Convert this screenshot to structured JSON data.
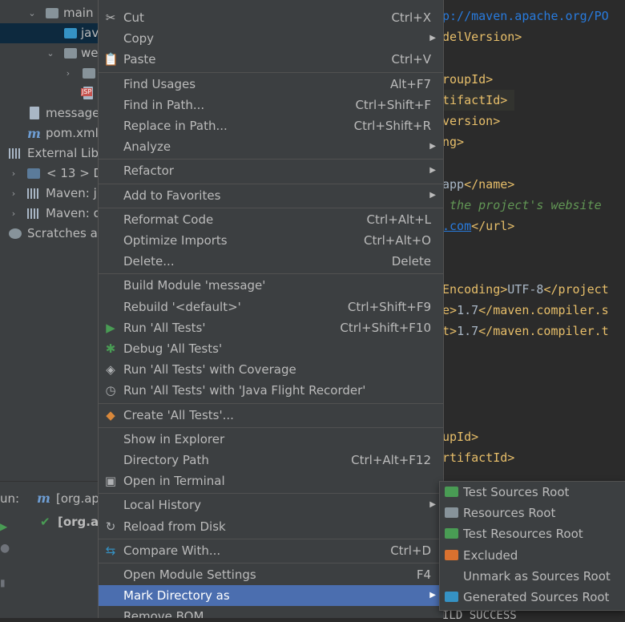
{
  "project_tree": {
    "rows": [
      {
        "label": "main"
      },
      {
        "label": "jav"
      },
      {
        "label": "we"
      },
      {
        "label": ""
      },
      {
        "label": "JSP"
      },
      {
        "label": "message"
      },
      {
        "label": "pom.xml"
      },
      {
        "label": "External Libr"
      },
      {
        "label": "< 13 >  D"
      },
      {
        "label": "Maven: ju"
      },
      {
        "label": "Maven: o"
      },
      {
        "label": "Scratches ar"
      }
    ],
    "maven_glyph": "m"
  },
  "editor": {
    "lines": [
      {
        "text": "p://maven.apache.org/PO",
        "kind": "url"
      },
      {
        "text": "delVersion>",
        "kind": "tag"
      },
      {
        "text": "",
        "kind": "txt"
      },
      {
        "text": "roupId>",
        "kind": "tag"
      },
      {
        "text": "tifactId>",
        "kind": "tag"
      },
      {
        "text": "version>",
        "kind": "tag"
      },
      {
        "text": "ng>",
        "kind": "tag"
      },
      {
        "text": "",
        "kind": "txt"
      },
      {
        "text": "app",
        "kind": "txt",
        "tail": "</name>"
      },
      {
        "text": " the project's website",
        "kind": "cmt"
      },
      {
        "text": ".com",
        "kind": "url",
        "tail": "</url>"
      },
      {
        "text": "",
        "kind": "txt"
      },
      {
        "text": "",
        "kind": "txt"
      },
      {
        "text": "Encoding>",
        "kind": "tag",
        "mid": "UTF-8",
        "tail": "</project"
      },
      {
        "text": "e>",
        "kind": "tag",
        "mid": "1.7",
        "tail": "</maven.compiler.s"
      },
      {
        "text": "t>",
        "kind": "tag",
        "mid": "1.7",
        "tail": "</maven.compiler.t"
      },
      {
        "text": "",
        "kind": "txt"
      },
      {
        "text": "",
        "kind": "txt"
      },
      {
        "text": "",
        "kind": "txt"
      },
      {
        "text": "",
        "kind": "txt"
      },
      {
        "text": "upId>",
        "kind": "tag"
      },
      {
        "text": "rtifactId>",
        "kind": "tag"
      }
    ]
  },
  "run_panel": {
    "tab_prefix": "un:",
    "tab_label": "[org.ap",
    "tree_item": "[org.ap",
    "build_log": "ILD SUCCESS"
  },
  "context_menu": {
    "items": [
      {
        "label": "Cut",
        "shortcut": "Ctrl+X",
        "icon": "scissors-icon",
        "glyph": "✂"
      },
      {
        "label": "Copy",
        "submenu": true
      },
      {
        "label": "Paste",
        "shortcut": "Ctrl+V",
        "icon": "clipboard-icon",
        "glyph": "📋"
      },
      {
        "label": "Find Usages",
        "shortcut": "Alt+F7",
        "sep_before": true
      },
      {
        "label": "Find in Path...",
        "shortcut": "Ctrl+Shift+F"
      },
      {
        "label": "Replace in Path...",
        "shortcut": "Ctrl+Shift+R"
      },
      {
        "label": "Analyze",
        "submenu": true
      },
      {
        "label": "Refactor",
        "submenu": true,
        "sep_before": true
      },
      {
        "label": "Add to Favorites",
        "submenu": true,
        "sep_before": true
      },
      {
        "label": "Reformat Code",
        "shortcut": "Ctrl+Alt+L",
        "sep_before": true
      },
      {
        "label": "Optimize Imports",
        "shortcut": "Ctrl+Alt+O"
      },
      {
        "label": "Delete...",
        "shortcut": "Delete"
      },
      {
        "label": "Build Module 'message'",
        "sep_before": true
      },
      {
        "label": "Rebuild '<default>'",
        "shortcut": "Ctrl+Shift+F9"
      },
      {
        "label": "Run 'All Tests'",
        "shortcut": "Ctrl+Shift+F10",
        "icon": "run-icon",
        "glyph": "▶",
        "color": "#499c54"
      },
      {
        "label": "Debug 'All Tests'",
        "icon": "debug-bug-icon",
        "glyph": "✱",
        "color": "#499c54"
      },
      {
        "label": "Run 'All Tests' with Coverage",
        "icon": "coverage-shield-icon",
        "glyph": "◈",
        "color": "#afb1b3"
      },
      {
        "label": "Run 'All Tests' with 'Java Flight Recorder'",
        "icon": "profiler-clock-icon",
        "glyph": "◷",
        "color": "#afb1b3"
      },
      {
        "label": "Create 'All Tests'...",
        "icon": "create-config-icon",
        "glyph": "◆",
        "color": "#d9883b",
        "sep_before": true
      },
      {
        "label": "Show in Explorer",
        "sep_before": true
      },
      {
        "label": "Directory Path",
        "shortcut": "Ctrl+Alt+F12"
      },
      {
        "label": "Open in Terminal",
        "icon": "terminal-icon",
        "glyph": "▣",
        "color": "#afb1b3"
      },
      {
        "label": "Local History",
        "submenu": true,
        "sep_before": true
      },
      {
        "label": "Reload from Disk",
        "icon": "reload-icon",
        "glyph": "↻",
        "color": "#afb1b3"
      },
      {
        "label": "Compare With...",
        "shortcut": "Ctrl+D",
        "icon": "compare-arrows-icon",
        "glyph": "⇆",
        "color": "#3592c4",
        "sep_before": true
      },
      {
        "label": "Open Module Settings",
        "shortcut": "F4",
        "sep_before": true
      },
      {
        "label": "Mark Directory as",
        "submenu": true,
        "active": true
      },
      {
        "label": "Remove BOM"
      }
    ]
  },
  "submenu": {
    "items": [
      {
        "label": "Test Sources Root",
        "icon": "test-sources-folder-icon",
        "color": "#499c54"
      },
      {
        "label": "Resources Root",
        "icon": "resources-folder-icon",
        "color": "#87939a"
      },
      {
        "label": "Test Resources Root",
        "icon": "test-resources-folder-icon",
        "color": "#499c54"
      },
      {
        "label": "Excluded",
        "icon": "excluded-folder-icon",
        "color": "#d9712f"
      },
      {
        "label": "Unmark as Sources Root",
        "icon": "",
        "color": ""
      },
      {
        "label": "Generated Sources Root",
        "icon": "generated-sources-folder-icon",
        "color": "#3592c4"
      }
    ]
  }
}
